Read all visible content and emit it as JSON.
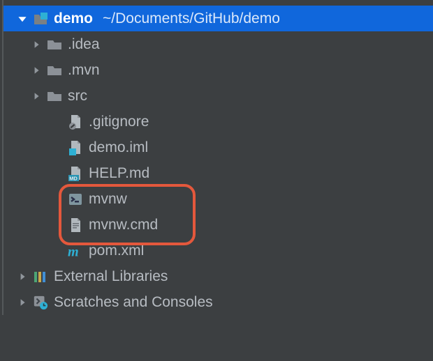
{
  "root": {
    "name": "demo",
    "path": "~/Documents/GitHub/demo",
    "expanded": true,
    "children": {
      "idea": {
        "name": ".idea",
        "expanded": false,
        "kind": "folder"
      },
      "mvn": {
        "name": ".mvn",
        "expanded": false,
        "kind": "folder"
      },
      "src": {
        "name": "src",
        "expanded": false,
        "kind": "folder"
      },
      "gitignore": {
        "name": ".gitignore",
        "kind": "file-ignored"
      },
      "iml": {
        "name": "demo.iml",
        "kind": "file-iml"
      },
      "help": {
        "name": "HELP.md",
        "kind": "file-md"
      },
      "mvnw": {
        "name": "mvnw",
        "kind": "file-shell"
      },
      "mvnwcmd": {
        "name": "mvnw.cmd",
        "kind": "file-text"
      },
      "pom": {
        "name": "pom.xml",
        "kind": "file-maven"
      }
    }
  },
  "ext_libs": {
    "name": "External Libraries",
    "expanded": false
  },
  "scratches": {
    "name": "Scratches and Consoles",
    "expanded": false
  },
  "highlighted": [
    "mvnw",
    "mvnw.cmd"
  ],
  "colors": {
    "selection": "#1067DC",
    "highlight_border": "#E4583C",
    "background": "#3C3F41",
    "accent_cyan": "#2EB0D4"
  }
}
